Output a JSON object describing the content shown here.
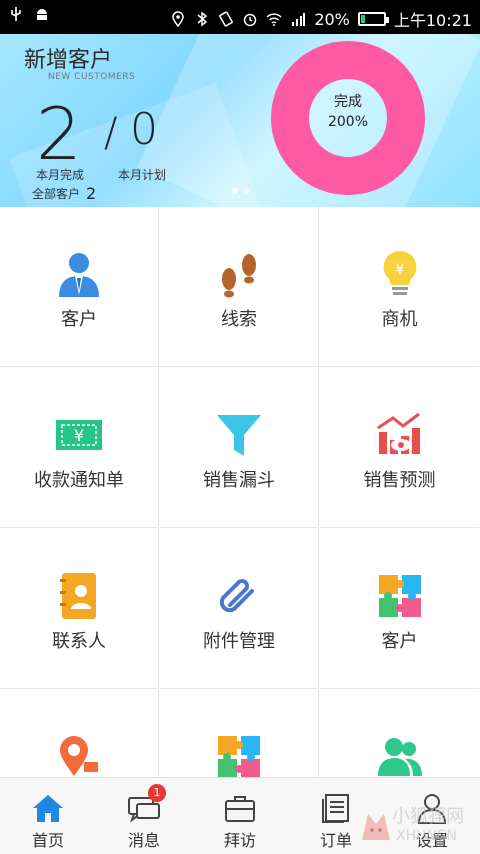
{
  "statusbar": {
    "battery": "20%",
    "time": "上午10:21",
    "battery_fill": 0.2
  },
  "banner": {
    "title": "新增客户",
    "subtitle": "NEW CUSTOMERS",
    "done_value": "2",
    "slash": "/",
    "plan_value": "0",
    "done_label": "本月完成",
    "plan_label": "本月计划",
    "all_label": "全部客户",
    "all_value": "2",
    "donut_label": "完成",
    "donut_value": "200%",
    "donut_color": "#ff5aa5",
    "page_count": 2,
    "active_page": 0
  },
  "grid": [
    {
      "label": "客户",
      "icon": "customer-icon"
    },
    {
      "label": "线索",
      "icon": "footprints-icon"
    },
    {
      "label": "商机",
      "icon": "lightbulb-yen-icon"
    },
    {
      "label": "收款通知单",
      "icon": "yen-ticket-icon"
    },
    {
      "label": "销售漏斗",
      "icon": "funnel-icon"
    },
    {
      "label": "销售预测",
      "icon": "forecast-chart-icon"
    },
    {
      "label": "联系人",
      "icon": "contacts-book-icon"
    },
    {
      "label": "附件管理",
      "icon": "paperclip-icon"
    },
    {
      "label": "客户",
      "icon": "puzzle-icon"
    },
    {
      "label": "",
      "icon": "location-icon"
    },
    {
      "label": "",
      "icon": "puzzle-icon"
    },
    {
      "label": "",
      "icon": "users-icon"
    }
  ],
  "tabs": [
    {
      "label": "首页",
      "icon": "home-icon"
    },
    {
      "label": "消息",
      "icon": "message-icon",
      "badge": "1"
    },
    {
      "label": "拜访",
      "icon": "briefcase-icon"
    },
    {
      "label": "订单",
      "icon": "document-icon"
    },
    {
      "label": "设置",
      "icon": "user-settings-icon"
    }
  ],
  "watermark": {
    "text": "小狐狸网",
    "sub": "XHLWCN"
  }
}
